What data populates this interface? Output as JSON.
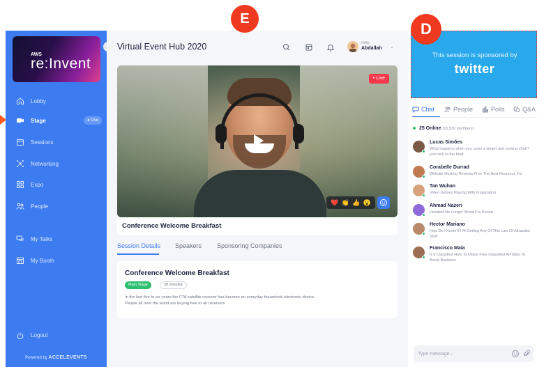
{
  "app": {
    "title": "Virtual Event Hub 2020"
  },
  "logo": {
    "aws": "AWS",
    "name": "re:Invent"
  },
  "sidebar": {
    "items": [
      {
        "label": "Lobby",
        "icon": "home-icon"
      },
      {
        "label": "Stage",
        "icon": "video-icon",
        "badge": "Live",
        "active": true
      },
      {
        "label": "Sessions",
        "icon": "calendar-icon"
      },
      {
        "label": "Networking",
        "icon": "network-icon"
      },
      {
        "label": "Expo",
        "icon": "grid-icon"
      },
      {
        "label": "People",
        "icon": "people-icon"
      },
      {
        "label": "My Talks",
        "icon": "chat-bubbles-icon"
      },
      {
        "label": "My Booth",
        "icon": "booth-icon"
      }
    ],
    "logout": "Logout",
    "powered_prefix": "Powered by",
    "powered_brand": "ACCELEVENTS"
  },
  "header": {
    "user": {
      "greeting": "Hello,",
      "name": "Abdallah"
    }
  },
  "video": {
    "live_label": "• Live",
    "caption": "Conference Welcome Breakfast",
    "reactions": [
      "❤️",
      "👏",
      "👍",
      "😮"
    ]
  },
  "session_tabs": {
    "items": [
      "Session Details",
      "Speakers",
      "Sponsoring Companies"
    ],
    "active": 0
  },
  "session_detail": {
    "title": "Conference Welcome Breakfast",
    "stage_tag": "Main Stage",
    "duration": "30 minutes",
    "description": "In the last five to six years the FTA satellite receiver has become an everyday household electronic device. People all over the world are buying free to air receivers"
  },
  "sponsor": {
    "text": "This session is sponsored by",
    "brand": "twitter"
  },
  "right_tabs": {
    "items": [
      "Chat",
      "People",
      "Polls",
      "Q&A"
    ],
    "active": 0
  },
  "online": {
    "count": "25 Online",
    "members": "(10,530 members)"
  },
  "chat": [
    {
      "name": "Lucas Simões",
      "message": "What happens when you cross a singer and rocking chair? you rock to the beat.",
      "avatar_color": "#7a5a44"
    },
    {
      "name": "Corabelle Durrad",
      "message": "Website Hosting Reviews Free The Best Resource For",
      "avatar_color": "#c07a52"
    },
    {
      "name": "Tan Wuhan",
      "message": "Video Games Playing With Imagination",
      "avatar_color": "#d8a27c"
    },
    {
      "name": "Ahmad Nazeri",
      "message": "Headset No Longer Wired For Sound",
      "avatar_color": "#8d6ad8"
    },
    {
      "name": "Hector Mariano",
      "message": "How Do I Know If I M Getting Any Of This Law Of Attraction Stuff",
      "avatar_color": "#b98a6a"
    },
    {
      "name": "Francisco Maia",
      "message": "It S Classified How To Utilize Free Classified Ad Sites To Boost Business",
      "avatar_color": "#9c6f55"
    }
  ],
  "message_box": {
    "placeholder": "Type message..."
  },
  "markers": {
    "e": "E",
    "d": "D"
  },
  "colors": {
    "primary": "#3d7cf0",
    "live": "#f5384b",
    "online": "#2fbf71",
    "sponsor_bg": "#29a9ec",
    "marker": "#f03a20"
  }
}
